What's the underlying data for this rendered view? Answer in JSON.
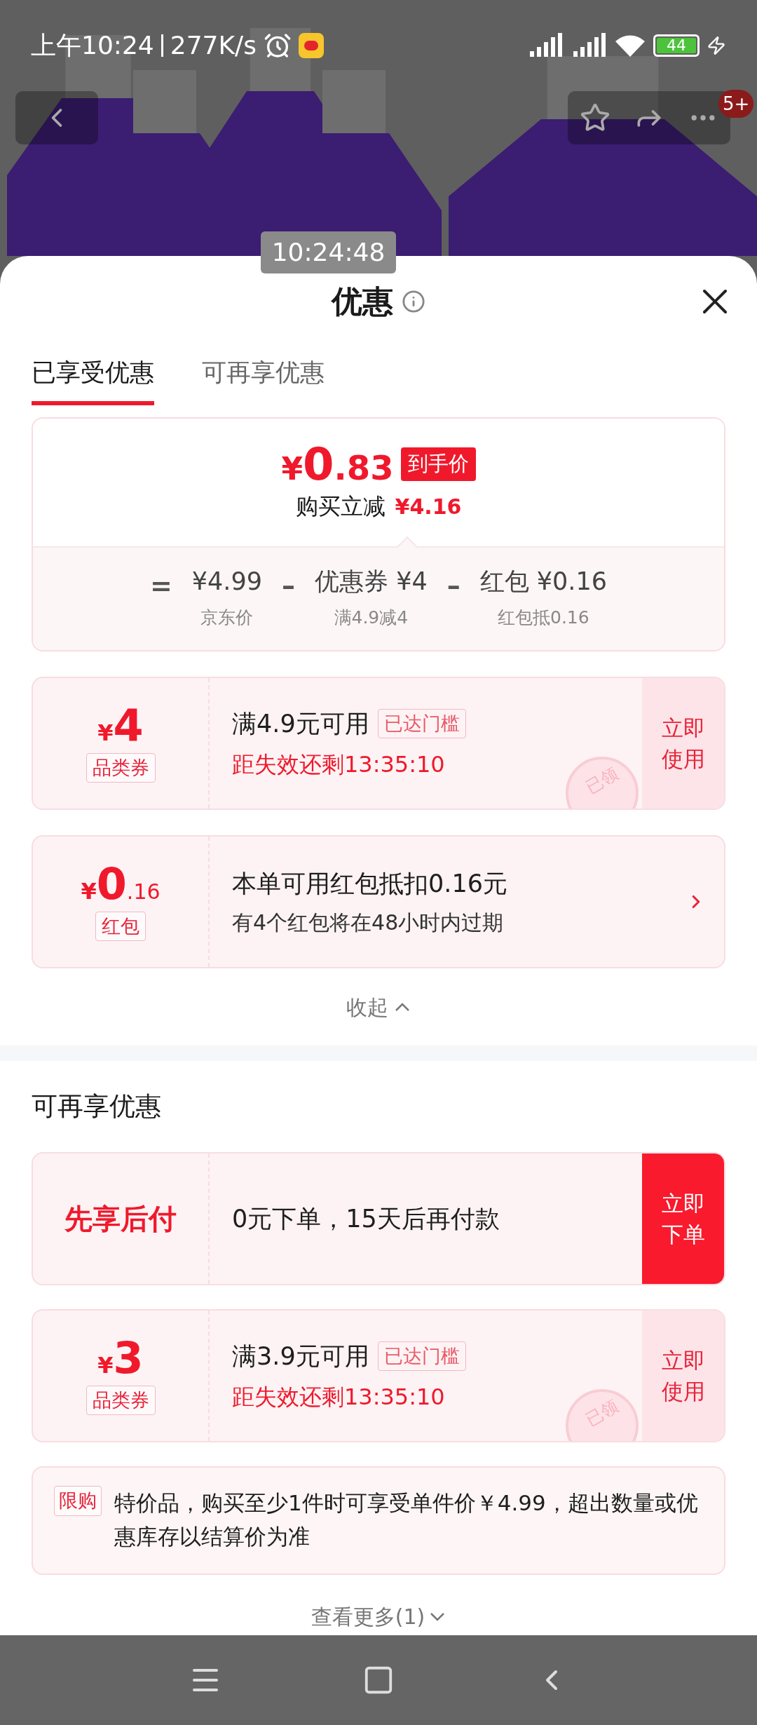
{
  "status_bar": {
    "time": "上午10:24",
    "speed": "277K/s",
    "battery": "44"
  },
  "product_header": {
    "kind": "picture",
    "badge": "5+"
  },
  "timestamp": "10:24:48",
  "sheet": {
    "title": "优惠"
  },
  "tabs": [
    {
      "label": "已享受优惠",
      "selected": true
    },
    {
      "label": "可再享优惠",
      "selected": false
    }
  ],
  "price_summary": {
    "symbol": "¥",
    "integer": "0",
    "decimal": ".83",
    "tag": "到手价",
    "saving_label": "购买立减",
    "saving_amount": "¥4.16",
    "breakdown": [
      {
        "operator": "=",
        "amount": "¥4.99",
        "note": "京东价"
      },
      {
        "operator": "–",
        "amount": "优惠券 ¥4",
        "note": "满4.9减4"
      },
      {
        "operator": "–",
        "amount": "红包 ¥0.16",
        "note": "红包抵0.16"
      }
    ]
  },
  "applied": [
    {
      "kind": "coupon",
      "symbol": "¥",
      "amount": "4",
      "tag": "品类券",
      "title": "满4.9元可用",
      "badge": "已达门槛",
      "subtitle": "距失效还剩13:35:10",
      "action": "立即使用",
      "stamp": "已领"
    },
    {
      "kind": "red_packet",
      "symbol": "¥",
      "amount": "0",
      "decimal": ".16",
      "tag": "红包",
      "title": "本单可用红包抵扣0.16元",
      "subtitle": "有4个红包将在48小时内过期"
    }
  ],
  "collapse": "收起",
  "more_section": {
    "title": "可再享优惠",
    "items": [
      {
        "kind": "pay_later",
        "label": "先享后付",
        "title": "0元下单，15天后再付款",
        "action": "立即下单"
      },
      {
        "kind": "coupon",
        "symbol": "¥",
        "amount": "3",
        "tag": "品类券",
        "title": "满3.9元可用",
        "badge": "已达门槛",
        "subtitle": "距失效还剩13:35:10",
        "action": "立即使用",
        "stamp": "已领"
      }
    ],
    "notice": {
      "tag": "限购",
      "text": "特价品，购买至少1件时可享受单件价￥4.99，超出数量或优惠库存以结算价为准"
    },
    "see_more": "查看更多(1)"
  }
}
